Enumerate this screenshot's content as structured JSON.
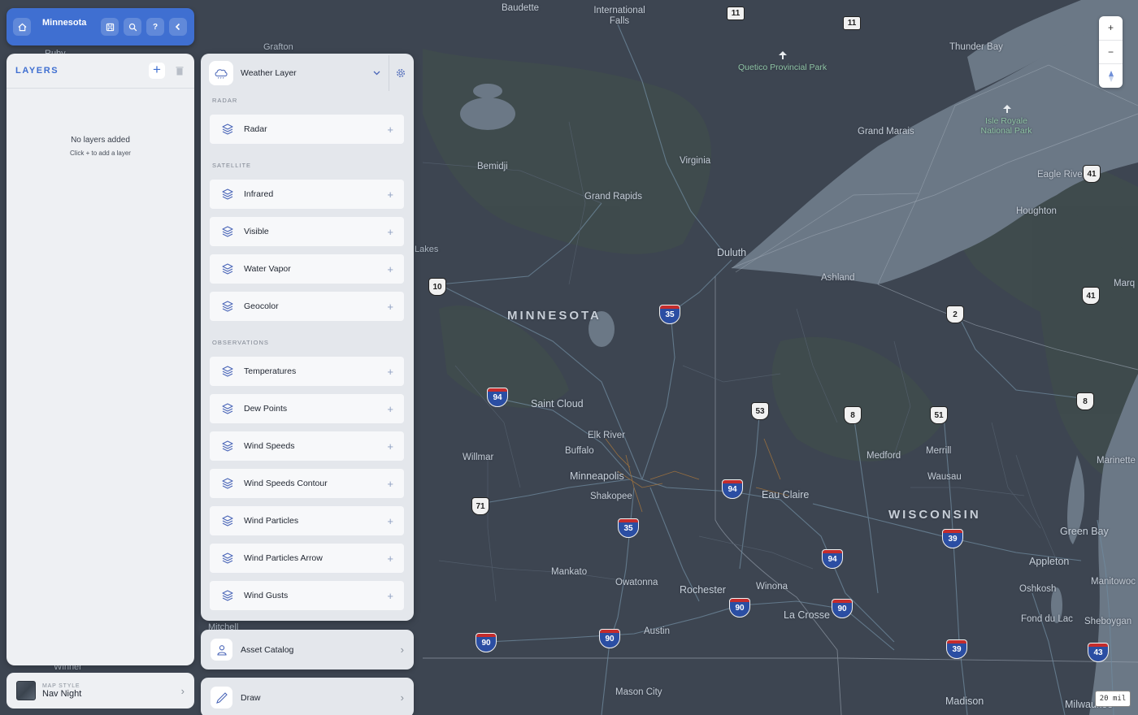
{
  "topbar": {
    "title": "Minnesota"
  },
  "layers_panel": {
    "title": "LAYERS",
    "empty_message": "No layers added",
    "empty_hint": "Click + to add a layer"
  },
  "map_style": {
    "label": "MAP STYLE",
    "value": "Nav Night"
  },
  "weather_panel": {
    "title": "Weather Layer",
    "sections": [
      {
        "name": "RADAR",
        "items": [
          "Radar"
        ]
      },
      {
        "name": "SATELLITE",
        "items": [
          "Infrared",
          "Visible",
          "Water Vapor",
          "Geocolor"
        ]
      },
      {
        "name": "OBSERVATIONS",
        "items": [
          "Temperatures",
          "Dew Points",
          "Wind Speeds",
          "Wind Speeds Contour",
          "Wind Particles",
          "Wind Particles Arrow",
          "Wind Gusts"
        ]
      }
    ]
  },
  "asset_catalog": {
    "label": "Asset Catalog"
  },
  "draw": {
    "label": "Draw"
  },
  "zoom": {
    "in": "+",
    "out": "−"
  },
  "scale": {
    "label": "20 mil"
  },
  "map": {
    "state_labels": [
      "MINNESOTA",
      "WISCONSIN"
    ],
    "places": [
      "Baudette",
      "International Falls",
      "Thunder Bay",
      "Grafton",
      "Ruby",
      "Quetico Provincial Park",
      "Isle Royale National Park",
      "Grand Marais",
      "Bemidji",
      "Virginia",
      "Grand Rapids",
      "Eagle River",
      "Houghton",
      "Duluth",
      "Ashland",
      "Lakes",
      "Marq",
      "Saint Cloud",
      "Elk River",
      "Buffalo",
      "Willmar",
      "Minneapolis",
      "Shakopee",
      "Eau Claire",
      "Medford",
      "Merrill",
      "Wausau",
      "Marinette",
      "Green Bay",
      "Appleton",
      "Oshkosh",
      "Manitowoc",
      "Fond du Lac",
      "Sheboygan",
      "Mankato",
      "Owatonna",
      "Rochester",
      "Winona",
      "La Crosse",
      "Austin",
      "Mitchell",
      "Winner",
      "Mason City",
      "Madison",
      "Milwaukee"
    ],
    "shields": [
      "11",
      "11",
      "10",
      "35",
      "41",
      "41",
      "2",
      "94",
      "53",
      "8",
      "51",
      "8",
      "94",
      "71",
      "35",
      "39",
      "94",
      "90",
      "90",
      "90",
      "90",
      "39",
      "43"
    ]
  }
}
